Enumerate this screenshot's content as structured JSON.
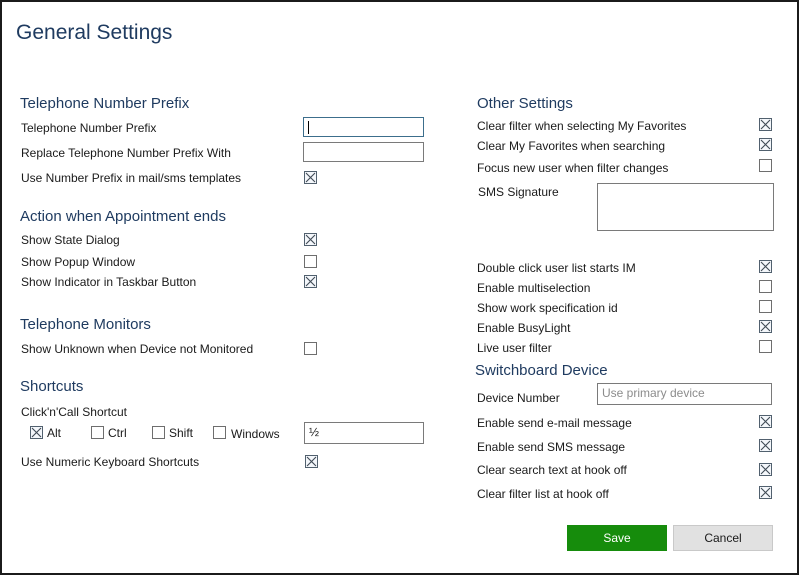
{
  "title": "General Settings",
  "telephone_prefix": {
    "heading": "Telephone Number Prefix",
    "prefix_label": "Telephone Number Prefix",
    "prefix_value": "",
    "replace_label": "Replace Telephone Number Prefix With",
    "replace_value": "",
    "use_in_templates_label": "Use Number Prefix in mail/sms templates",
    "use_in_templates_checked": true
  },
  "appointment": {
    "heading": "Action when Appointment ends",
    "items": [
      {
        "label": "Show State Dialog",
        "checked": true
      },
      {
        "label": "Show Popup Window",
        "checked": false
      },
      {
        "label": "Show Indicator in Taskbar Button",
        "checked": true
      }
    ]
  },
  "monitors": {
    "heading": "Telephone Monitors",
    "show_unknown_label": "Show Unknown when Device not Monitored",
    "show_unknown_checked": false
  },
  "shortcuts": {
    "heading": "Shortcuts",
    "click_call_label": "Click'n'Call Shortcut",
    "modifiers": [
      {
        "label": "Alt",
        "checked": true
      },
      {
        "label": "Ctrl",
        "checked": false
      },
      {
        "label": "Shift",
        "checked": false
      },
      {
        "label": "Windows",
        "checked": false
      }
    ],
    "key_value": "½",
    "numeric_keyboard_label": "Use Numeric Keyboard Shortcuts",
    "numeric_keyboard_checked": true
  },
  "other": {
    "heading": "Other Settings",
    "items": [
      {
        "label": "Clear filter when selecting My Favorites",
        "checked": true
      },
      {
        "label": "Clear My Favorites when searching",
        "checked": true
      },
      {
        "label": "Focus new user when filter changes",
        "checked": false
      }
    ],
    "sms_signature_label": "SMS Signature",
    "sms_signature_value": "",
    "items2": [
      {
        "label": "Double click user list starts IM",
        "checked": true
      },
      {
        "label": "Enable  multiselection",
        "checked": false
      },
      {
        "label": "Show work specification id",
        "checked": false
      },
      {
        "label": "Enable BusyLight",
        "checked": true
      },
      {
        "label": "Live user filter",
        "checked": false
      }
    ]
  },
  "switchboard": {
    "heading": "Switchboard Device",
    "device_number_label": "Device Number",
    "device_number_placeholder": "Use primary device",
    "items": [
      {
        "label": "Enable send e-mail message",
        "checked": true
      },
      {
        "label": "Enable send SMS message",
        "checked": true
      },
      {
        "label": "Clear search text at hook off",
        "checked": true
      },
      {
        "label": "Clear filter list at hook off",
        "checked": true
      }
    ]
  },
  "buttons": {
    "save": "Save",
    "cancel": "Cancel"
  },
  "colors": {
    "accent_heading": "#1f3b60",
    "save_button": "#168c0c"
  }
}
